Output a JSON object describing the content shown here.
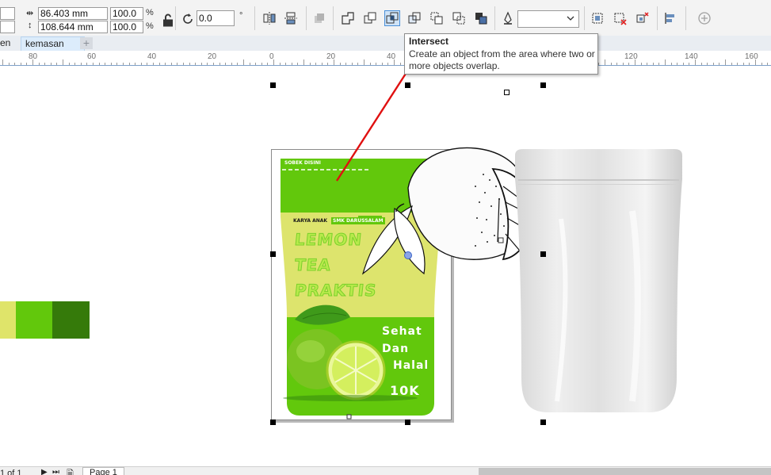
{
  "toolbar": {
    "width_value": "86.403 mm",
    "height_value": "108.644 mm",
    "scale_x": "100.0",
    "scale_y": "100.0",
    "percent": "%",
    "rotation": "0.0",
    "degree": "°"
  },
  "tabs": [
    {
      "label": "en"
    },
    {
      "label": "kemasan"
    }
  ],
  "add_tab_label": "+",
  "ruler_labels": [
    "80",
    "60",
    "40",
    "20",
    "0",
    "20",
    "40",
    "120",
    "140",
    "160"
  ],
  "tooltip": {
    "title": "Intersect",
    "description": "Create an object from the area where two or more objects overlap."
  },
  "package": {
    "tear_text": "SOBEK DISINI",
    "maker_text": "KARYA ANAK",
    "school_text": "SMK DARUSSALAM",
    "product_lines": [
      "LEMON",
      "TEA",
      "PRAKTIS"
    ],
    "side_lines": [
      "Sehat",
      "Dan",
      "Halal"
    ],
    "price": "10K"
  },
  "swatches": [
    "#dfe46a",
    "#62c80c",
    "#357a0a"
  ],
  "status": {
    "page_count": "1 of 1",
    "page_tab": "Page 1"
  },
  "colors": {
    "accent_blue": "#2d77c8",
    "package_green": "#62c80c",
    "package_light": "#dde46d",
    "annotation_red": "#e01010"
  }
}
